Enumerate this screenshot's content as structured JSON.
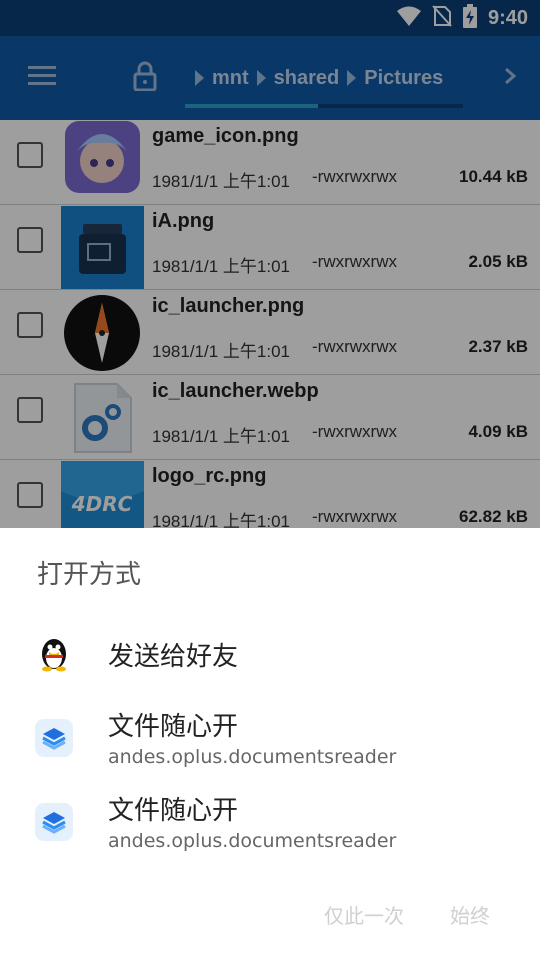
{
  "status_bar": {
    "time": "9:40",
    "icons": [
      "wifi-icon",
      "no-sim-icon",
      "battery-charging-icon"
    ]
  },
  "app_bar": {
    "menu_icon": "menu-icon",
    "lock_icon": "lock-icon",
    "breadcrumb": [
      "mnt",
      "shared",
      "Pictures"
    ],
    "more_icon": "chevron-right-icon",
    "path_scroll_fraction": 0.48,
    "colors": {
      "primary": "#0f5aa8",
      "status_bar": "#0a3f77",
      "progress": "#2aa4c8"
    }
  },
  "files": [
    {
      "name": "game_icon.png",
      "date": "1981/1/1 上午1:01",
      "perm": "-rwxrwxrwx",
      "size": "10.44 kB"
    },
    {
      "name": "iA.png",
      "date": "1981/1/1 上午1:01",
      "perm": "-rwxrwxrwx",
      "size": "2.05 kB"
    },
    {
      "name": "ic_launcher.png",
      "date": "1981/1/1 上午1:01",
      "perm": "-rwxrwxrwx",
      "size": "2.37 kB"
    },
    {
      "name": "ic_launcher.webp",
      "date": "1981/1/1 上午1:01",
      "perm": "-rwxrwxrwx",
      "size": "4.09 kB"
    },
    {
      "name": "logo_rc.png",
      "date": "1981/1/1 上午1:01",
      "perm": "-rwxrwxrwx",
      "size": "62.82 kB"
    }
  ],
  "thumb_text": {
    "logo_rc": "4DRC"
  },
  "sheet": {
    "title": "打开方式",
    "apps": [
      {
        "label": "发送给好友",
        "package": "",
        "icon": "qq-penguin-icon"
      },
      {
        "label": "文件随心开",
        "package": "andes.oplus.documentsreader",
        "icon": "documents-reader-icon"
      },
      {
        "label": "文件随心开",
        "package": "andes.oplus.documentsreader",
        "icon": "documents-reader-icon"
      }
    ],
    "just_once": "仅此一次",
    "always": "始终"
  }
}
